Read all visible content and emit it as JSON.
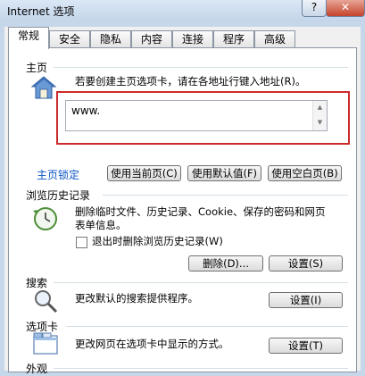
{
  "window": {
    "title": "Internet 选项",
    "help_label": "?",
    "close_label": "✕"
  },
  "tabs": [
    "常规",
    "安全",
    "隐私",
    "内容",
    "连接",
    "程序",
    "高级"
  ],
  "home": {
    "section": "主页",
    "instruction": "若要创建主页选项卡，请在各地址行键入地址(R)。",
    "address_value": "www.",
    "link_label": "主页锁定",
    "btn_current": "使用当前页(C)",
    "btn_default": "使用默认值(F)",
    "btn_blank": "使用空白页(B)"
  },
  "history": {
    "section": "浏览历史记录",
    "desc": "删除临时文件、历史记录、Cookie、保存的密码和网页表单信息。",
    "checkbox_label": "退出时删除浏览历史记录(W)",
    "btn_delete": "删除(D)...",
    "btn_settings": "设置(S)"
  },
  "search": {
    "section": "搜索",
    "desc": "更改默认的搜索提供程序。",
    "btn_settings": "设置(I)"
  },
  "tabs_section": {
    "section": "选项卡",
    "desc": "更改网页在选项卡中显示的方式。",
    "btn_settings": "设置(T)"
  },
  "appearance": {
    "section": "外观"
  },
  "colors": {
    "accent": "#0a56c4",
    "highlight": "#cc2b2b",
    "panel_border": "#8c96a3"
  },
  "icons": [
    "house-icon",
    "history-clock-icon",
    "magnifier-icon",
    "tabs-window-icon"
  ]
}
